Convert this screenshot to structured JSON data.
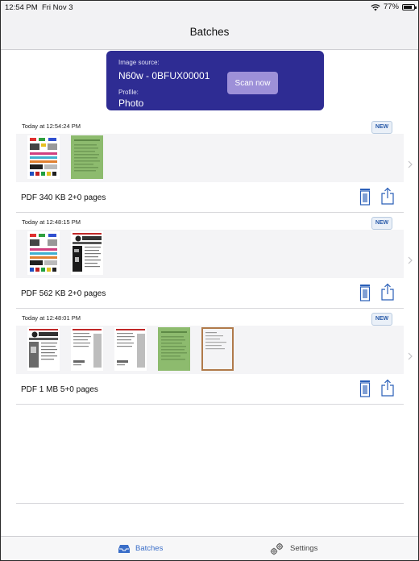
{
  "status_bar": {
    "time": "12:54 PM",
    "date": "Fri Nov 3",
    "battery": "77%"
  },
  "nav": {
    "title": "Batches"
  },
  "source": {
    "image_source_label": "Image source:",
    "image_source_value": "N60w - 0BFUX00001",
    "profile_label": "Profile:",
    "profile_value": "Photo",
    "scan_button": "Scan now",
    "card_color": "#2e2c93",
    "button_color": "#9d90d8"
  },
  "batches": [
    {
      "timestamp": "Today at 12:54:24 PM",
      "badge": "NEW",
      "info": "PDF  340 KB  2+0 pages",
      "thumbnails": [
        "color-test-chart",
        "green-document"
      ]
    },
    {
      "timestamp": "Today at 12:48:15 PM",
      "badge": "NEW",
      "info": "PDF  562 KB  2+0 pages",
      "thumbnails": [
        "color-test-chart",
        "object-twain-page"
      ]
    },
    {
      "timestamp": "Today at 12:48:01 PM",
      "badge": "NEW",
      "info": "PDF  1 MB  5+0 pages",
      "thumbnails": [
        "object-twain-page",
        "text-page",
        "text-page",
        "green-document",
        "form-page-brown-border"
      ]
    }
  ],
  "tabs": [
    {
      "label": "Batches",
      "icon": "tray-icon",
      "selected": true
    },
    {
      "label": "Settings",
      "icon": "gears-icon",
      "selected": false
    }
  ],
  "colors": {
    "accent": "#3a6ec8",
    "badge_text": "#2b5caa"
  }
}
